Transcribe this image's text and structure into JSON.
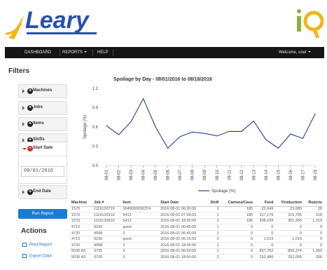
{
  "brand": {
    "logo_text": "Leary",
    "product_logo_text": "iQ",
    "logo_color": "#2a4fb0",
    "accent_color": "#f1b51c",
    "iq_i_color": "#8ab33c",
    "iq_q_color": "#f1b51c"
  },
  "nav": {
    "dashboard": "DASHBOARD",
    "reports": "REPORTS",
    "help": "HELP",
    "welcome": "Welcome, user"
  },
  "sidebar": {
    "filters_title": "Filters",
    "filters": [
      {
        "label": "Machines"
      },
      {
        "label": "Jobs"
      },
      {
        "label": "Items"
      },
      {
        "label": "Shifts"
      }
    ],
    "start_date_label": "Start Date",
    "start_date_value": "08/01/2016",
    "end_date_label": "End Date",
    "run_report": "Run Report",
    "actions_title": "Actions",
    "print_report": "Print Report",
    "export_data": "Export Data"
  },
  "chart_data": {
    "type": "line",
    "title": "Spoilage by Day - 08/01/2016 to 08/18/2016",
    "ylabel": "Spoilage (%)",
    "xlabel": "",
    "ylim": [
      0,
      1.2
    ],
    "yticks": [
      "0.0",
      "0.3",
      "0.6",
      "0.9",
      "1.2"
    ],
    "categories": [
      "08-01",
      "08-02",
      "08-03",
      "08-04",
      "08-05",
      "08-06",
      "08-07",
      "08-08",
      "08-09",
      "08-10",
      "08-11",
      "08-12",
      "08-13",
      "08-14",
      "08-15",
      "08-16",
      "08-17",
      "08-18"
    ],
    "series": [
      {
        "name": "Spoilage (%)",
        "color": "#2b3f8c",
        "values": [
          0.62,
          0.48,
          0.68,
          1.04,
          0.6,
          0.27,
          0.45,
          0.52,
          0.5,
          0.46,
          0.53,
          0.53,
          0.69,
          0.4,
          0.27,
          0.49,
          0.42,
          0.8
        ]
      }
    ],
    "legend": "bottom-center",
    "grid": false
  },
  "table": {
    "columns": [
      "Machine",
      "Job #",
      "Item",
      "Start Date",
      "Shift",
      "Cartons/Case",
      "Feed",
      "Production",
      "Rejects"
    ],
    "rows": [
      [
        "1570",
        "1119120719",
        "0049000036374",
        "2016-08-01 06:30:00",
        "1",
        "185",
        "22,649",
        "23,680",
        "29"
      ],
      [
        "1570",
        "1119120910",
        "5412",
        "2016-08-01 07:38:03",
        "1",
        "185",
        "317,176",
        "315,795",
        "518"
      ],
      [
        "1570",
        "1119120910",
        "5412",
        "2016-08-01 18:30:00",
        "2",
        "185",
        "306,028",
        "301,365",
        "1,319"
      ],
      [
        "4710",
        "9236",
        "good",
        "2016-08-01 06:45:00",
        "1",
        "0",
        "0",
        "0",
        "0"
      ],
      [
        "4720",
        "9098",
        "2",
        "2016-08-01 06:45:00",
        "1",
        "0",
        "0",
        "0",
        "0"
      ],
      [
        "4710",
        "9236",
        "good",
        "2016-08-02 05:15:59",
        "2",
        "0",
        "1,019",
        "1,010",
        "9"
      ],
      [
        "4720",
        "9098",
        "2",
        "2016-08-01 18:45:00",
        "2",
        "0",
        "0",
        "0",
        "0"
      ],
      [
        "5530 A3",
        "3735",
        "3",
        "2016-08-01 06:50:00",
        "1",
        "0",
        "857,752",
        "856,374",
        "1,393"
      ],
      [
        "5530 A3",
        "3735",
        "3",
        "2016-08-01 18:50:00",
        "2",
        "0",
        "252,486",
        "252,055",
        "306"
      ]
    ]
  }
}
